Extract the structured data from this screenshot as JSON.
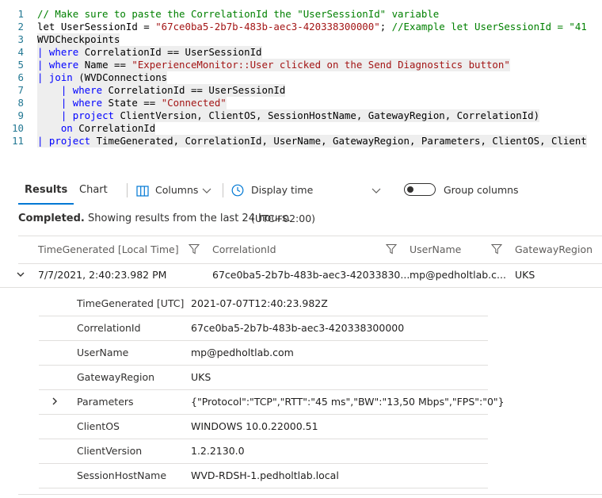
{
  "editor": {
    "lines": [
      {
        "num": "1",
        "segments": [
          {
            "t": "// Make sure to paste the CorrelationId the \"UserSessionId\" variable",
            "c": "comment"
          }
        ]
      },
      {
        "num": "2",
        "segments": [
          {
            "t": "let UserSessionId = ",
            "c": "plain"
          },
          {
            "t": "\"67ce0ba5-2b7b-483b-aec3-420338300000\"",
            "c": "string"
          },
          {
            "t": "; ",
            "c": "plain"
          },
          {
            "t": "//Example let UserSessionId = \"41",
            "c": "comment"
          }
        ]
      },
      {
        "num": "3",
        "segments": [
          {
            "t": "WVDCheckpoints",
            "c": "plain"
          }
        ]
      },
      {
        "num": "4",
        "segments": [
          {
            "t": "| ",
            "c": "pipe"
          },
          {
            "t": "where",
            "c": "keyword"
          },
          {
            "t": " CorrelationId == UserSessionId",
            "c": "plain"
          }
        ]
      },
      {
        "num": "5",
        "segments": [
          {
            "t": "| ",
            "c": "pipe"
          },
          {
            "t": "where",
            "c": "keyword"
          },
          {
            "t": " Name == ",
            "c": "plain"
          },
          {
            "t": "\"ExperienceMonitor::User clicked on the Send Diagnostics button\"",
            "c": "string"
          }
        ]
      },
      {
        "num": "6",
        "segments": [
          {
            "t": "| ",
            "c": "pipe"
          },
          {
            "t": "join",
            "c": "keyword"
          },
          {
            "t": " (WVDConnections",
            "c": "plain"
          }
        ]
      },
      {
        "num": "7",
        "segments": [
          {
            "t": "    | ",
            "c": "pipe"
          },
          {
            "t": "where",
            "c": "keyword"
          },
          {
            "t": " CorrelationId == UserSessionId",
            "c": "plain"
          }
        ]
      },
      {
        "num": "8",
        "segments": [
          {
            "t": "    | ",
            "c": "pipe"
          },
          {
            "t": "where",
            "c": "keyword"
          },
          {
            "t": " State == ",
            "c": "plain"
          },
          {
            "t": "\"Connected\"",
            "c": "string"
          }
        ]
      },
      {
        "num": "9",
        "segments": [
          {
            "t": "    | ",
            "c": "pipe"
          },
          {
            "t": "project",
            "c": "keyword"
          },
          {
            "t": " ClientVersion, ClientOS, SessionHostName, GatewayRegion, CorrelationId)",
            "c": "plain"
          }
        ]
      },
      {
        "num": "10",
        "segments": [
          {
            "t": "    ",
            "c": "plain"
          },
          {
            "t": "on",
            "c": "keyword"
          },
          {
            "t": " CorrelationId",
            "c": "plain"
          }
        ]
      },
      {
        "num": "11",
        "segments": [
          {
            "t": "| ",
            "c": "pipe"
          },
          {
            "t": "project",
            "c": "keyword"
          },
          {
            "t": " TimeGenerated, CorrelationId, UserName, GatewayRegion, Parameters, ClientOS, Client",
            "c": "plain"
          }
        ]
      }
    ]
  },
  "toolbar": {
    "results_tab": "Results",
    "chart_tab": "Chart",
    "columns_label": "Columns",
    "display_time_label": "Display time (UTC+02:00)",
    "group_columns_label": "Group columns"
  },
  "status": {
    "bold": "Completed.",
    "text": " Showing results from the last 24 hours."
  },
  "grid": {
    "headers": [
      "TimeGenerated [Local Time]",
      "CorrelationId",
      "UserName",
      "GatewayRegion"
    ],
    "row": [
      "7/7/2021, 2:40:23.982 PM",
      "67ce0ba5-2b7b-483b-aec3-42033830...",
      "mp@pedholtlab.c...",
      "UKS"
    ]
  },
  "details": [
    {
      "key": "TimeGenerated [UTC]",
      "value": "2021-07-07T12:40:23.982Z"
    },
    {
      "key": "CorrelationId",
      "value": "67ce0ba5-2b7b-483b-aec3-420338300000"
    },
    {
      "key": "UserName",
      "value": "mp@pedholtlab.com"
    },
    {
      "key": "GatewayRegion",
      "value": "UKS"
    },
    {
      "key": "Parameters",
      "value": "{\"Protocol\":\"TCP\",\"RTT\":\"45 ms\",\"BW\":\"13,50 Mbps\",\"FPS\":\"0\"}",
      "expandable": true
    },
    {
      "key": "ClientOS",
      "value": "WINDOWS 10.0.22000.51"
    },
    {
      "key": "ClientVersion",
      "value": "1.2.2130.0"
    },
    {
      "key": "SessionHostName",
      "value": "WVD-RDSH-1.pedholtlab.local"
    }
  ],
  "colors": {
    "accent": "#0078d4",
    "keyword": "#0000ff",
    "string": "#a31515",
    "comment": "#008000"
  },
  "icons": [
    "columns-icon",
    "chevron-down-icon",
    "clock-icon",
    "filter-icon",
    "chevron-right-icon"
  ]
}
